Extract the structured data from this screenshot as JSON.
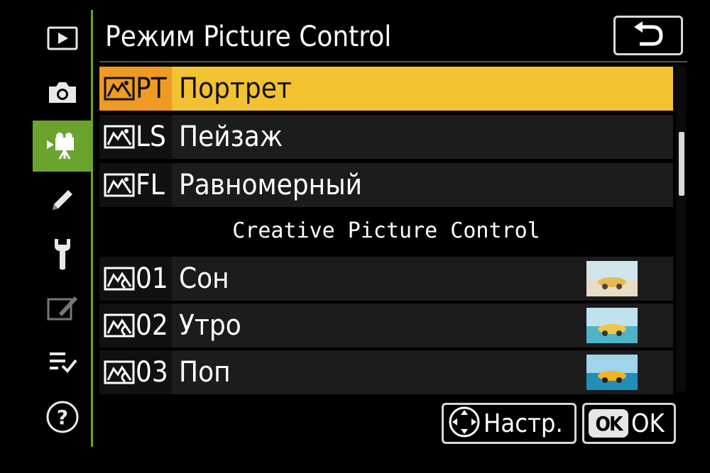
{
  "header": {
    "title": "Режим Picture Control",
    "back_icon": "return-arrow-icon"
  },
  "sidebar": {
    "items": [
      {
        "name": "playback",
        "icon": "playback-icon",
        "active": false
      },
      {
        "name": "photo-shooting",
        "icon": "camera-icon",
        "active": false
      },
      {
        "name": "movie-shooting",
        "icon": "movie-camera-icon",
        "active": true
      },
      {
        "name": "custom-settings",
        "icon": "pencil-icon",
        "active": false
      },
      {
        "name": "setup",
        "icon": "wrench-icon",
        "active": false
      },
      {
        "name": "retouch",
        "icon": "retouch-icon",
        "active": false
      },
      {
        "name": "my-menu",
        "icon": "my-menu-icon",
        "active": false
      },
      {
        "name": "help",
        "icon": "help-icon",
        "active": false
      }
    ]
  },
  "list": {
    "rows": [
      {
        "code": "PT",
        "label": "Портрет",
        "selected": true,
        "thumbnail": false
      },
      {
        "code": "LS",
        "label": "Пейзаж",
        "selected": false,
        "thumbnail": false
      },
      {
        "code": "FL",
        "label": "Равномерный",
        "selected": false,
        "thumbnail": false
      }
    ],
    "section_header": "Creative Picture Control",
    "creative_rows": [
      {
        "code": "01",
        "label": "Сон",
        "selected": false,
        "thumbnail": true
      },
      {
        "code": "02",
        "label": "Утро",
        "selected": false,
        "thumbnail": true
      },
      {
        "code": "03",
        "label": "Поп",
        "selected": false,
        "thumbnail": true
      }
    ]
  },
  "footer": {
    "setup_label": "Настр.",
    "setup_icon": "multi-selector-icon",
    "ok_badge": "OK",
    "ok_label": "OK"
  },
  "colors": {
    "accent_green": "#6aa42e",
    "selected_row": "#f2c230",
    "selected_code": "#ef9a22"
  }
}
